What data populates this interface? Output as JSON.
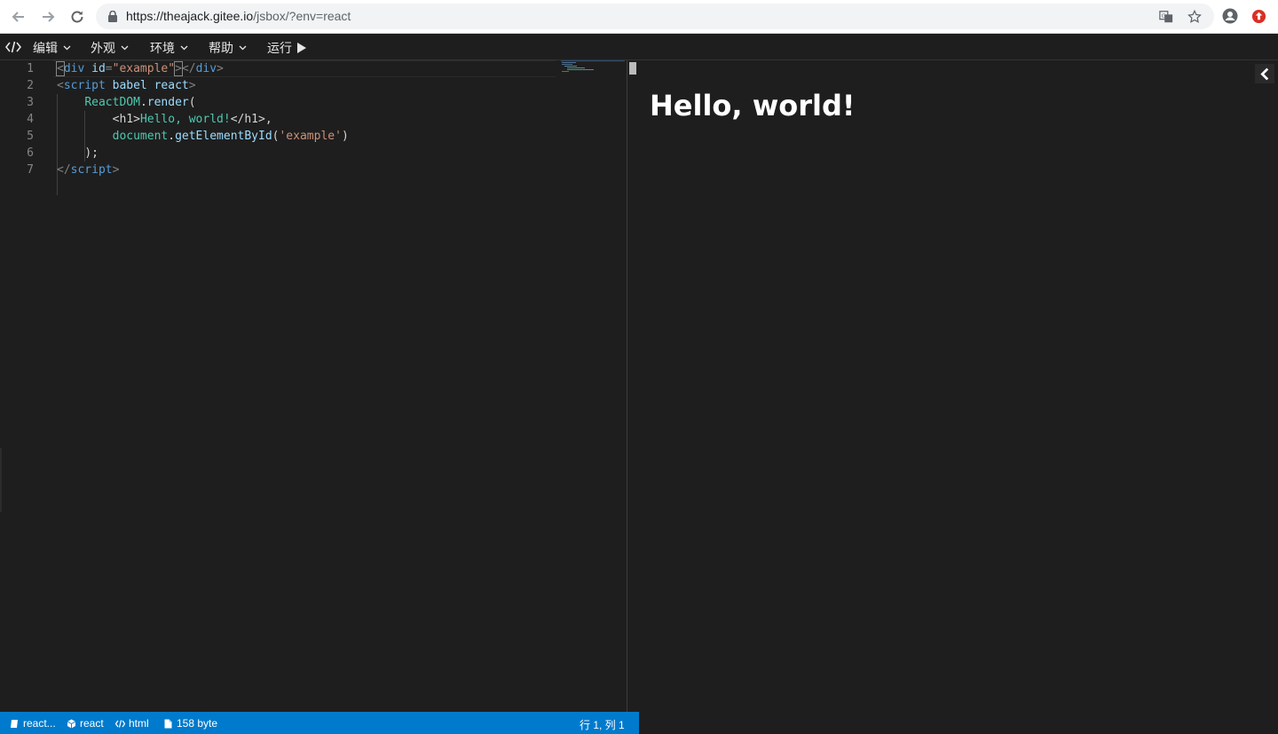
{
  "browser": {
    "url_main": "https://theajack.gitee.io",
    "url_path": "/jsbox/?env=react"
  },
  "menu": {
    "items": [
      {
        "label": "编辑"
      },
      {
        "label": "外观"
      },
      {
        "label": "环境"
      },
      {
        "label": "帮助"
      }
    ],
    "run_label": "运行"
  },
  "editor": {
    "line_numbers": [
      "1",
      "2",
      "3",
      "4",
      "5",
      "6",
      "7"
    ],
    "lines": [
      [
        {
          "t": "<",
          "c": "punc"
        },
        {
          "t": "div",
          "c": "tag"
        },
        {
          "t": " ",
          "c": "plain"
        },
        {
          "t": "id",
          "c": "attr"
        },
        {
          "t": "=",
          "c": "punc"
        },
        {
          "t": "\"example\"",
          "c": "str"
        },
        {
          "t": ">",
          "c": "punc"
        },
        {
          "t": "</",
          "c": "punc"
        },
        {
          "t": "div",
          "c": "tag"
        },
        {
          "t": ">",
          "c": "punc"
        }
      ],
      [
        {
          "t": "<",
          "c": "punc"
        },
        {
          "t": "script",
          "c": "tag"
        },
        {
          "t": " ",
          "c": "plain"
        },
        {
          "t": "babel",
          "c": "attr"
        },
        {
          "t": " ",
          "c": "plain"
        },
        {
          "t": "react",
          "c": "attr"
        },
        {
          "t": ">",
          "c": "punc"
        }
      ],
      [
        {
          "t": "    ",
          "c": "plain"
        },
        {
          "t": "ReactDOM",
          "c": "obj"
        },
        {
          "t": ".",
          "c": "plain"
        },
        {
          "t": "render",
          "c": "attr"
        },
        {
          "t": "(",
          "c": "plain"
        }
      ],
      [
        {
          "t": "        ",
          "c": "plain"
        },
        {
          "t": "<h1>",
          "c": "plain"
        },
        {
          "t": "Hello, world!",
          "c": "obj"
        },
        {
          "t": "</h1>",
          "c": "plain"
        },
        {
          "t": ",",
          "c": "plain"
        }
      ],
      [
        {
          "t": "        ",
          "c": "plain"
        },
        {
          "t": "document",
          "c": "obj"
        },
        {
          "t": ".",
          "c": "plain"
        },
        {
          "t": "getElementById",
          "c": "attr"
        },
        {
          "t": "(",
          "c": "plain"
        },
        {
          "t": "'example'",
          "c": "str"
        },
        {
          "t": ")",
          "c": "plain"
        }
      ],
      [
        {
          "t": "    ",
          "c": "plain"
        },
        {
          "t": ");",
          "c": "plain"
        }
      ],
      [
        {
          "t": "</",
          "c": "punc"
        },
        {
          "t": "script",
          "c": "tag"
        },
        {
          "t": ">",
          "c": "punc"
        }
      ]
    ]
  },
  "status": {
    "file_label": "react...",
    "env_label": "react",
    "lang_label": "html",
    "size_label": "158 byte",
    "cursor_label": "行 1, 列 1"
  },
  "preview": {
    "heading": "Hello, world!"
  },
  "colors": {
    "statusbar": "#007acc",
    "editor_bg": "#1e1e1e",
    "tag": "#569cd6",
    "string": "#ce9178",
    "object": "#4ec9b0"
  }
}
